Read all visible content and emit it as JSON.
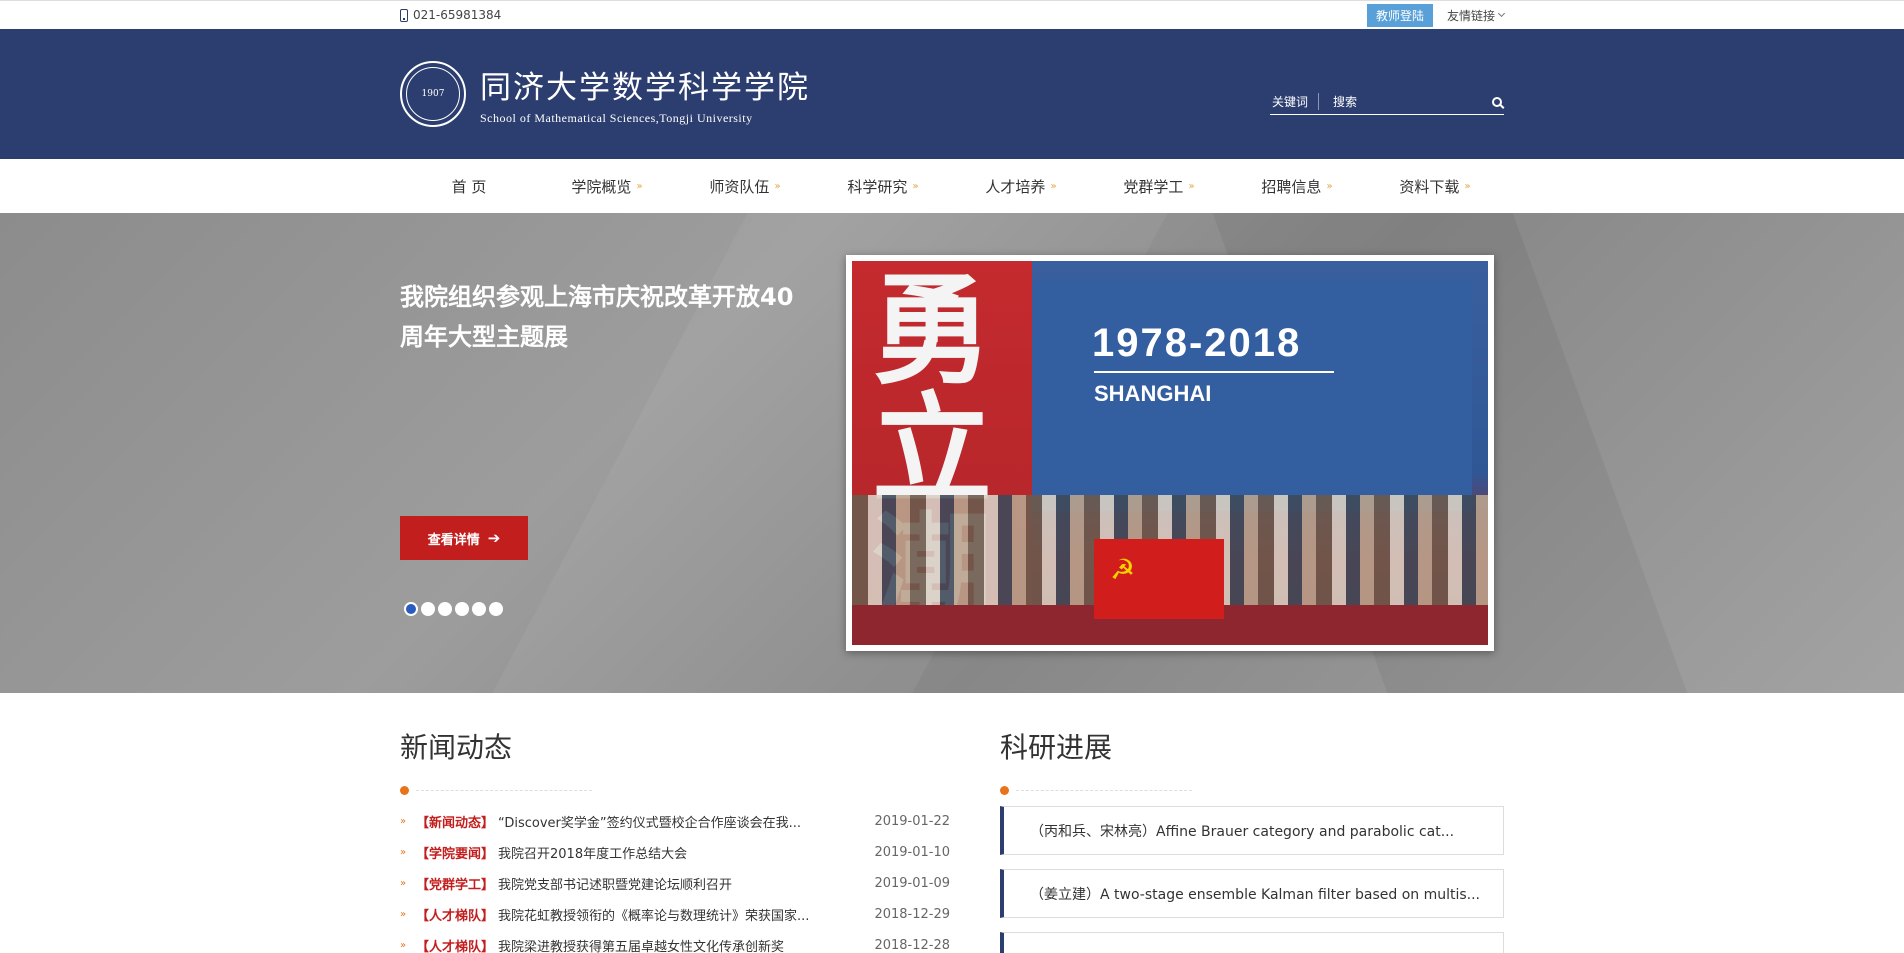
{
  "topbar": {
    "phone": "021-65981384",
    "login": "教师登陆",
    "links": "友情链接"
  },
  "header": {
    "seal_text": "1907",
    "name_cn": "同济大学数学科学学院",
    "name_en": "School of Mathematical Sciences,Tongji University",
    "search_keyword_label": "关键词",
    "search_placeholder": "搜索"
  },
  "nav": [
    {
      "label": "首  页",
      "has_arrow": false
    },
    {
      "label": "学院概览",
      "has_arrow": true
    },
    {
      "label": "师资队伍",
      "has_arrow": true
    },
    {
      "label": "科学研究",
      "has_arrow": true
    },
    {
      "label": "人才培养",
      "has_arrow": true
    },
    {
      "label": "党群学工",
      "has_arrow": true
    },
    {
      "label": "招聘信息",
      "has_arrow": true
    },
    {
      "label": "资料下载",
      "has_arrow": true
    }
  ],
  "banner": {
    "title": "我院组织参观上海市庆祝改革开放40周年大型主题展",
    "button": "查看详情",
    "slides": 6,
    "active_slide": 1,
    "photo": {
      "glyph": "勇立潮头",
      "year": "1978-2018",
      "city": "SHANGHAI"
    }
  },
  "news": {
    "title": "新闻动态",
    "items": [
      {
        "category": "【新闻动态】",
        "title": "“Discover奖学金”签约仪式暨校企合作座谈会在我...",
        "date": "2019-01-22"
      },
      {
        "category": "【学院要闻】",
        "title": "我院召开2018年度工作总结大会",
        "date": "2019-01-10"
      },
      {
        "category": "【党群学工】",
        "title": "我院党支部书记述职暨党建论坛顺利召开",
        "date": "2019-01-09"
      },
      {
        "category": "【人才梯队】",
        "title": "我院花虹教授领衔的《概率论与数理统计》荣获国家...",
        "date": "2018-12-29"
      },
      {
        "category": "【人才梯队】",
        "title": "我院梁进教授获得第五届卓越女性文化传承创新奖",
        "date": "2018-12-28"
      }
    ]
  },
  "research": {
    "title": "科研进展",
    "items": [
      {
        "text": "（丙和兵、宋林亮）Affine Brauer category and  parabolic cat..."
      },
      {
        "text": "（姜立建）A two-stage ensemble Kalman filter based on multis..."
      },
      {
        "text": ""
      }
    ]
  },
  "colors": {
    "header_bg": "#2c3e70",
    "accent_red": "#c31e1e",
    "accent_orange": "#e8731a",
    "login_blue": "#5aa0d8"
  }
}
